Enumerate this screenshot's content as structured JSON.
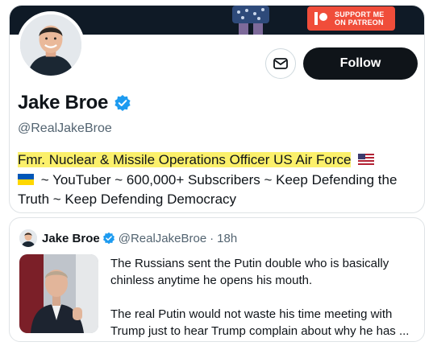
{
  "colors": {
    "accent_blue": "#1d9bf0",
    "follow_bg": "#0f1419",
    "highlight": "#fbf06b",
    "patreon": "#f04d3a",
    "muted_text": "#536471"
  },
  "banner": {
    "patreon_line1": "SUPPORT ME",
    "patreon_line2": "ON PATREON"
  },
  "profile": {
    "display_name": "Jake Broe",
    "handle": "@RealJakeBroe",
    "verified": true,
    "follow_label": "Follow",
    "message_icon": "envelope-icon",
    "bio_highlighted": "Fmr. Nuclear & Missile Operations Officer US Air Force",
    "bio_rest": " ~ YouTuber ~ 600,000+ Subscribers ~ Keep Defending the Truth ~ Keep Defending Democracy",
    "bio_flag_1": "us-flag-icon",
    "bio_flag_2": "ukraine-flag-icon"
  },
  "tweet": {
    "author_name": "Jake Broe",
    "author_handle": "@RealJakeBroe",
    "separator": "·",
    "time": "18h",
    "paragraphs": [
      "The Russians sent the Putin double who is basically chinless anytime he opens his mouth.",
      "The real Putin would not waste his time meeting with Trump just to hear Trump complain about why he has ..."
    ]
  }
}
